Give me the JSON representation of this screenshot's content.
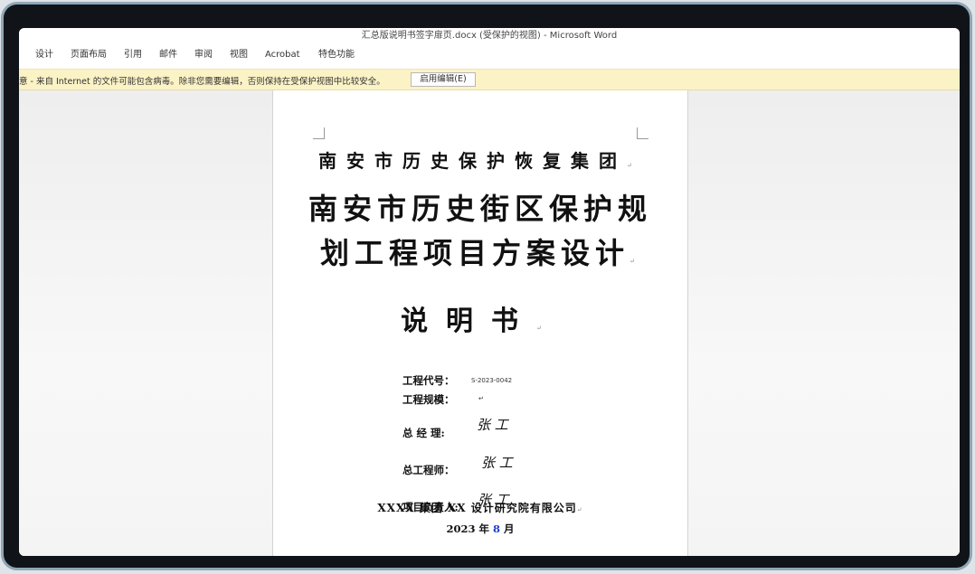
{
  "window": {
    "title": "汇总版说明书签字扉页.docx (受保护的视图) - Microsoft Word"
  },
  "ribbon": {
    "tabs": [
      "设计",
      "页面布局",
      "引用",
      "邮件",
      "审阅",
      "视图",
      "Acrobat",
      "特色功能"
    ]
  },
  "infobar": {
    "message": "意 - 来自 Internet 的文件可能包含病毒。除非您需要编辑，否则保持在受保护视图中比较安全。",
    "enable_button": "启用编辑(E)",
    "color": "#fbf3c6"
  },
  "document": {
    "org": "南安市历史保护恢复集团",
    "title_line1": "南安市历史街区保护规",
    "title_line2": "划工程项目方案设计",
    "subtitle": "说明书",
    "fields": {
      "project_code_label": "工程代号：",
      "project_code_value": "S-2023-0042",
      "project_scale_label": "工程规模：",
      "gm_label": "总 经 理:",
      "chief_engineer_label": "总工程师：",
      "pm_label": "项目负责人:",
      "signature": "张 工"
    },
    "company": "XXXX 集团 XX 设计研究院有限公司",
    "date_year": "2023 年",
    "date_month": "8",
    "date_suffix": "月",
    "paragraph_mark": "↵",
    "accent_color": "#1a3fd6"
  }
}
